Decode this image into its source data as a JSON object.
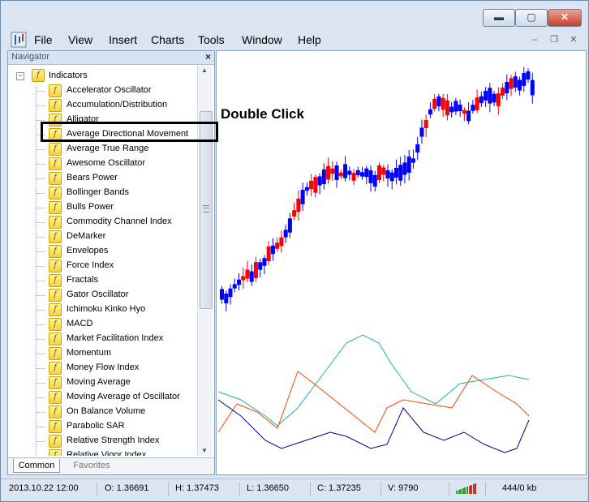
{
  "menu": [
    "File",
    "View",
    "Insert",
    "Charts",
    "Tools",
    "Window",
    "Help"
  ],
  "window_controls": {
    "minimize": "▬",
    "maximize": "▢",
    "close": "✕"
  },
  "mdi_controls": {
    "minimize": "‒",
    "restore": "❐",
    "close": "✕"
  },
  "navigator": {
    "title": "Navigator",
    "close": "×",
    "root": "Indicators",
    "items": [
      "Accelerator Oscillator",
      "Accumulation/Distribution",
      "Alligator",
      "Average Directional Movement",
      "Average True Range",
      "Awesome Oscillator",
      "Bears Power",
      "Bollinger Bands",
      "Bulls Power",
      "Commodity Channel Index",
      "DeMarker",
      "Envelopes",
      "Force Index",
      "Fractals",
      "Gator Oscillator",
      "Ichimoku Kinko Hyo",
      "MACD",
      "Market Facilitation Index",
      "Momentum",
      "Money Flow Index",
      "Moving Average",
      "Moving Average of Oscillator",
      "On Balance Volume",
      "Parabolic SAR",
      "Relative Strength Index",
      "Relative Vigor Index"
    ],
    "tabs": [
      "Common",
      "Favorites"
    ]
  },
  "callout": "Double Click",
  "status": {
    "datetime": "2013.10.22 12:00",
    "open": "O: 1.36691",
    "high": "H: 1.37473",
    "low": "L: 1.36650",
    "close": "C: 1.37235",
    "volume": "V: 9790",
    "traffic": "444/0 kb"
  },
  "colors": {
    "bull": "#0000ff",
    "bear": "#ff0000",
    "line1": "#20b2aa",
    "line2": "#ff4500",
    "line3": "#00008b"
  }
}
